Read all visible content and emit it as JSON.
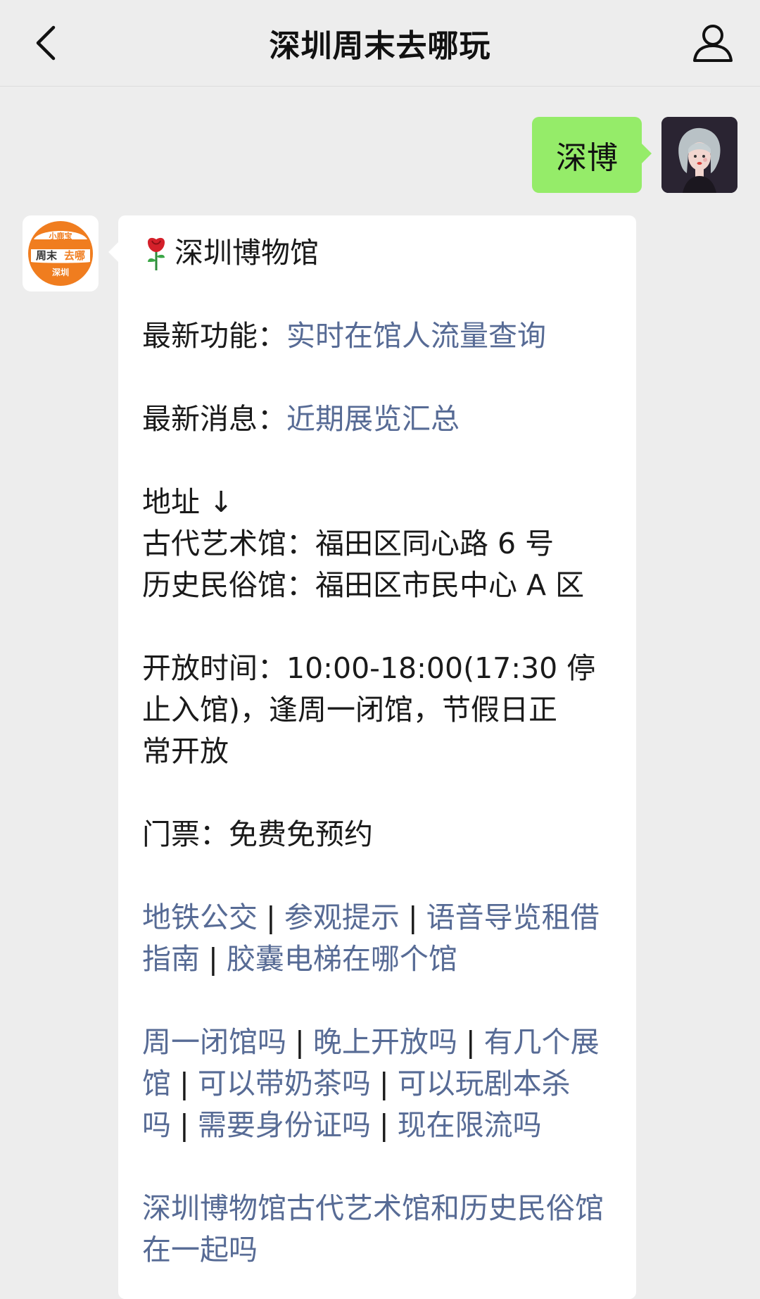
{
  "nav": {
    "title": "深圳周末去哪玩"
  },
  "user_message": {
    "text": "深博"
  },
  "bot": {
    "avatar": {
      "top": "小鹿宝",
      "middle_a": "周末",
      "middle_b": "去哪",
      "bottom": "深圳"
    },
    "title": "深圳博物馆",
    "title_icon": "rose-icon",
    "new_feature_label": "最新功能：",
    "new_feature_link": "实时在馆人流量查询",
    "new_news_label": "最新消息：",
    "new_news_link": "近期展览汇总",
    "address_heading": "地址 ↓",
    "address_1": "古代艺术馆：福田区同心路 6 号",
    "address_2": "历史民俗馆：福田区市民中心 A 区",
    "hours_1": "开放时间：10:00-18:00(17:30 停",
    "hours_2": "止入馆)，逢周一闭馆，节假日正",
    "hours_3": "常开放",
    "ticket": "门票：免费免预约",
    "links_group1": [
      "地铁公交",
      "参观提示",
      "语音导览租借指南",
      "胶囊电梯在哪个馆"
    ],
    "links_group2": [
      "周一闭馆吗",
      "晚上开放吗",
      "有几个展馆",
      "可以带奶茶吗",
      "可以玩剧本杀吗",
      "需要身份证吗",
      "现在限流吗"
    ],
    "links_group3": "深圳博物馆古代艺术馆和历史民俗馆在一起吗",
    "separator": "|"
  },
  "colors": {
    "link": "#576b95",
    "user_bubble": "#95ec69",
    "background": "#ededed",
    "logo_orange": "#f07d1f"
  }
}
